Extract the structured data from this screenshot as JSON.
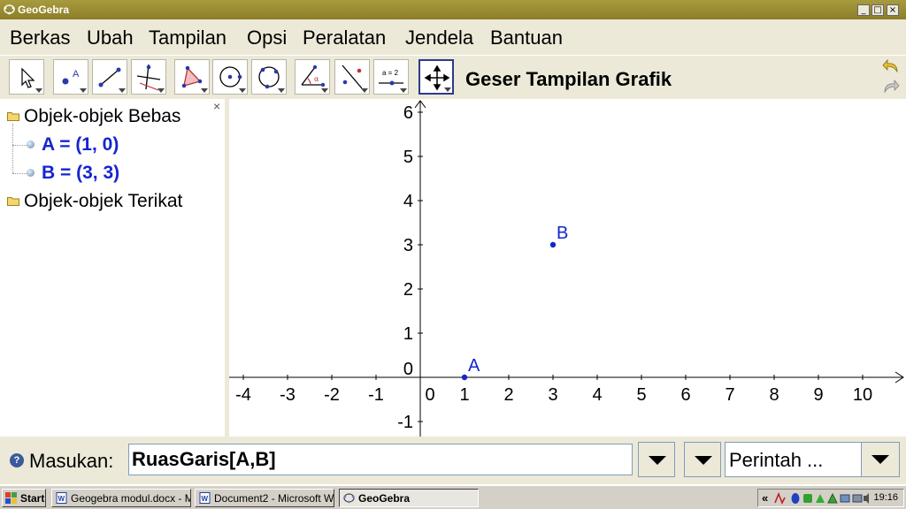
{
  "window": {
    "title": "GeoGebra"
  },
  "menu": [
    "Berkas",
    "Ubah",
    "Tampilan",
    "Opsi",
    "Peralatan",
    "Jendela",
    "Bantuan"
  ],
  "toolbar": {
    "active_tool_name": "Geser Tampilan Grafik",
    "tools": [
      "move-tool",
      "point-tool",
      "line-tool",
      "perpendicular-tool",
      "polygon-tool",
      "circle-tool",
      "circle-three-points-tool",
      "angle-tool",
      "reflect-tool",
      "slider-tool",
      "move-view-tool"
    ],
    "slider_tool_label": "a = 2"
  },
  "algebra": {
    "free_folder": "Objek-objek Bebas",
    "objects": [
      {
        "text": "A = (1, 0)"
      },
      {
        "text": "B = (3, 3)"
      }
    ],
    "dependent_folder": "Objek-objek Terikat",
    "close": "×"
  },
  "graphics": {
    "x_ticks": [
      "-4",
      "-3",
      "-2",
      "-1",
      "0",
      "1",
      "2",
      "3",
      "4",
      "5",
      "6",
      "7",
      "8",
      "9",
      "10"
    ],
    "y_ticks": [
      "-1",
      "0",
      "1",
      "2",
      "3",
      "4",
      "5",
      "6"
    ],
    "points": [
      {
        "label": "A",
        "x": 1,
        "y": 0
      },
      {
        "label": "B",
        "x": 3,
        "y": 3
      }
    ],
    "point_color": "#1525d0"
  },
  "input": {
    "label": "Masukan:",
    "value": "RuasGaris[A,B]",
    "command_select": "Perintah ..."
  },
  "taskbar": {
    "start": "Start",
    "tasks": [
      {
        "label": "Geogebra modul.docx - M..."
      },
      {
        "label": "Document2 - Microsoft W..."
      },
      {
        "label": "GeoGebra"
      }
    ],
    "tray_chevron": "«",
    "clock": "19:16"
  }
}
